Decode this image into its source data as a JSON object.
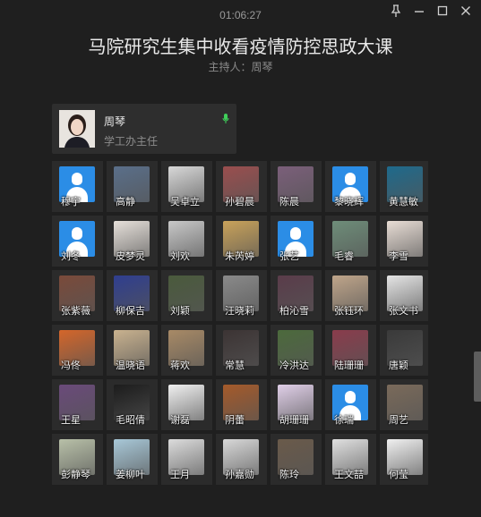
{
  "timer": "01:06:27",
  "title": "马院研究生集中收看疫情防控思政大课",
  "subtitle": "主持人：周琴",
  "host": {
    "name": "周琴",
    "role": "学工办主任",
    "mic_color": "#3fcf5a"
  },
  "participants": [
    {
      "name": "穆宇",
      "bg": "person"
    },
    {
      "name": "高静",
      "bg": "#5a6f8a"
    },
    {
      "name": "吴卓立",
      "bg": "#d8d8d8"
    },
    {
      "name": "孙碧晨",
      "bg": "#9a4e4e"
    },
    {
      "name": "陈晨",
      "bg": "#7b5f7a"
    },
    {
      "name": "黎晓辉",
      "bg": "person"
    },
    {
      "name": "黄慧敏",
      "bg": "#1e6a8c"
    },
    {
      "name": "刘冬",
      "bg": "person"
    },
    {
      "name": "皮梦灵",
      "bg": "#e6e0da"
    },
    {
      "name": "刘欢",
      "bg": "#c8c8c8"
    },
    {
      "name": "朱芮婷",
      "bg": "#c9a25a"
    },
    {
      "name": "张艺",
      "bg": "person"
    },
    {
      "name": "毛睿",
      "bg": "#6e8d79"
    },
    {
      "name": "李雪",
      "bg": "#e8ddd5"
    },
    {
      "name": "张紫薇",
      "bg": "#7a4a3a"
    },
    {
      "name": "柳保吉",
      "bg": "#2f3e8f"
    },
    {
      "name": "刘颖",
      "bg": "#4a5a3c"
    },
    {
      "name": "汪晓莉",
      "bg": "#8a8a8a"
    },
    {
      "name": "柏沁雪",
      "bg": "#5a3c4a"
    },
    {
      "name": "张钰环",
      "bg": "#bfa58a"
    },
    {
      "name": "张文书",
      "bg": "#e5e5e5"
    },
    {
      "name": "冯佟",
      "bg": "#d4662a"
    },
    {
      "name": "温晓语",
      "bg": "#c9b28f"
    },
    {
      "name": "蒋欢",
      "bg": "#a88a66"
    },
    {
      "name": "常慧",
      "bg": "#3c3434"
    },
    {
      "name": "冷洪达",
      "bg": "#4c6a3c"
    },
    {
      "name": "陆珊珊",
      "bg": "#8a3c4c"
    },
    {
      "name": "唐颖",
      "bg": "#3a3a3a"
    },
    {
      "name": "王星",
      "bg": "#6a4a7a"
    },
    {
      "name": "毛昭倩",
      "bg": "#1c1c1c"
    },
    {
      "name": "谢磊",
      "bg": "#f0f0f0"
    },
    {
      "name": "阴蕾",
      "bg": "#a55a2a"
    },
    {
      "name": "胡珊珊",
      "bg": "#e0cfe8"
    },
    {
      "name": "徐瑞",
      "bg": "person"
    },
    {
      "name": "周艺",
      "bg": "#7a6a5a"
    },
    {
      "name": "彭静琴",
      "bg": "#b8c0a8"
    },
    {
      "name": "姜柳叶",
      "bg": "#a8c8d8"
    },
    {
      "name": "王月",
      "bg": "#dcdcdc"
    },
    {
      "name": "孙嘉勋",
      "bg": "#d8d8d8"
    },
    {
      "name": "陈玲",
      "bg": "#6a5a4a"
    },
    {
      "name": "王文喆",
      "bg": "#e0e0e0"
    },
    {
      "name": "何莹",
      "bg": "#f0f0f0"
    }
  ]
}
